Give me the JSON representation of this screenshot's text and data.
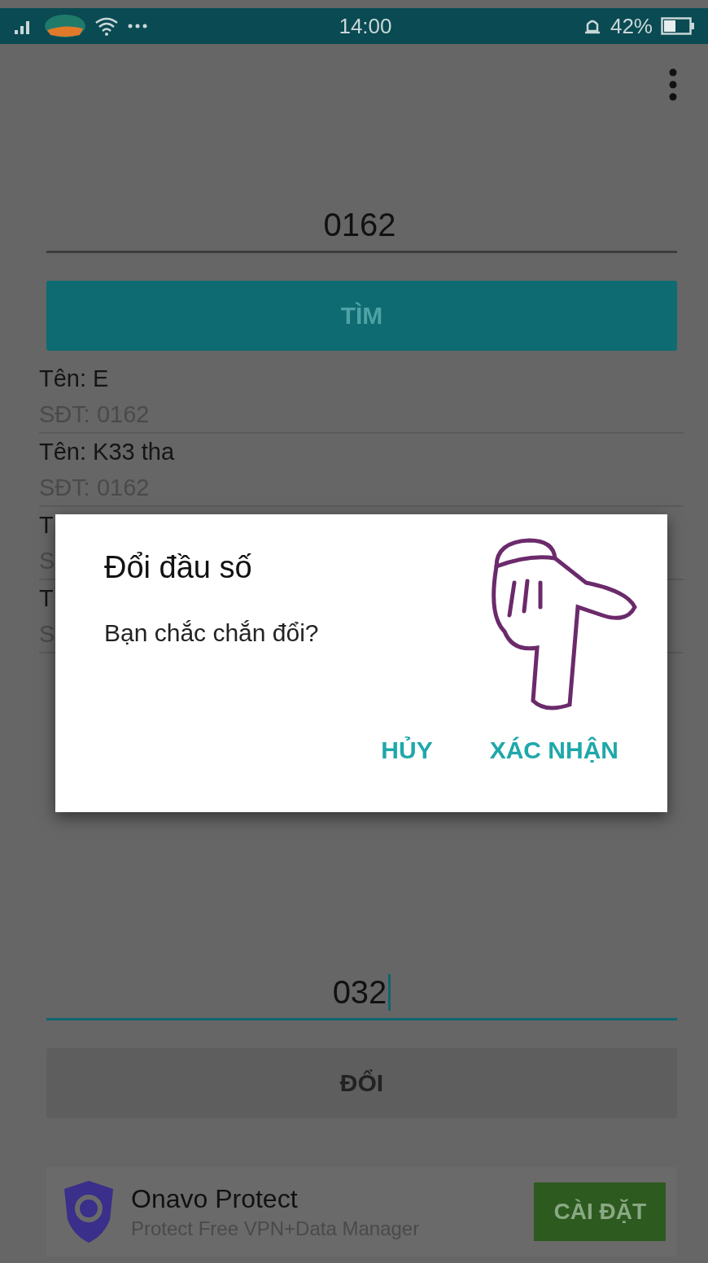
{
  "status_bar": {
    "time": "14:00",
    "battery": "42%"
  },
  "search": {
    "value": "0162",
    "focused": false,
    "button": "TÌM"
  },
  "results": [
    {
      "name": "Tên: E",
      "phone": "SĐT: 0162"
    },
    {
      "name": "Tên: K33 tha",
      "phone": "SĐT: 0162"
    },
    {
      "name": "T",
      "phone": "S"
    },
    {
      "name": "T",
      "phone": "S"
    }
  ],
  "dialog": {
    "title": "Đổi đầu số",
    "message": "Bạn chắc chắn đổi?",
    "buttons": [
      "HỦY",
      "XÁC NHẬN"
    ]
  },
  "change": {
    "value": "032",
    "focused": true,
    "button": "ĐỔI"
  },
  "ad": {
    "title": "Onavo Protect",
    "subtitle": "Protect Free VPN+Data Manager",
    "button": "CÀI ĐẶT"
  }
}
